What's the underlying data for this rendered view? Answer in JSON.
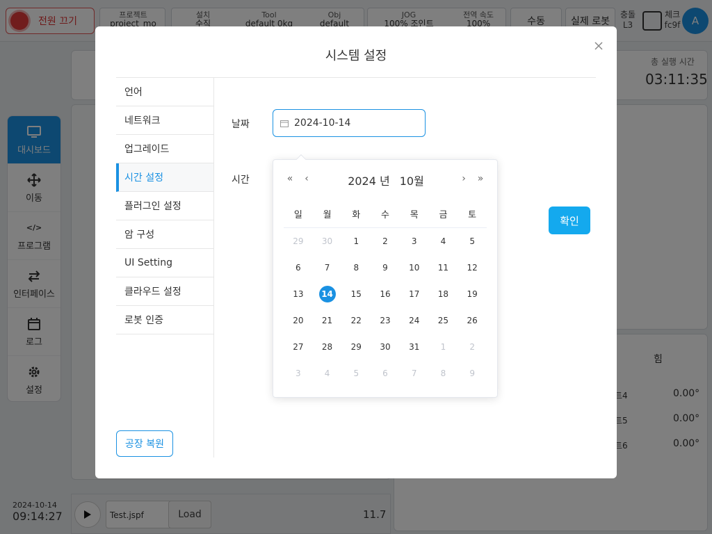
{
  "topbar": {
    "power_label": "전원 끄기",
    "project_label": "프로젝트",
    "project_value": "project_mo",
    "install_label": "설치",
    "install_value": "수직",
    "tool_label": "Tool",
    "tool_value": "default",
    "tool_weight": "0kg",
    "obj_label": "Obj",
    "obj_value": "default",
    "jog_label": "JOG",
    "jog_value": "100%",
    "jog_mode": "조인트",
    "speed_label": "전역 속도",
    "speed_value": "100%",
    "manual_label": "수동",
    "robot_label": "실제 로봇",
    "collision_label": "충돌",
    "collision_value": "L3",
    "check_label": "체크",
    "check_value": "fc9f",
    "avatar": "A"
  },
  "sidenav": {
    "items": [
      {
        "label": "대시보드",
        "icon": "monitor-icon"
      },
      {
        "label": "이동",
        "icon": "move-icon"
      },
      {
        "label": "프로그램",
        "icon": "code-icon"
      },
      {
        "label": "인터페이스",
        "icon": "swap-icon"
      },
      {
        "label": "로그",
        "icon": "calendar-icon"
      },
      {
        "label": "설정",
        "icon": "gear-icon"
      }
    ]
  },
  "background": {
    "runtime_label": "총 실행 시간",
    "runtime_value": "03:11:35",
    "force_label": "힘",
    "joints": [
      {
        "label": "트4",
        "value": "0.00°"
      },
      {
        "label": "트5",
        "value": "0.00°"
      },
      {
        "label": "트6",
        "value": "0.00°"
      }
    ],
    "date": "2024-10-14",
    "time": "09:14:27",
    "file_name": "Test.jspf",
    "load_label": "Load",
    "speed_readout": "11.7"
  },
  "modal": {
    "title": "시스템 설정",
    "menu": [
      "언어",
      "네트워크",
      "업그레이드",
      "시간 설정",
      "플러그인 설정",
      "암 구성",
      "UI Setting",
      "클라우드 설정",
      "로봇 인증"
    ],
    "active_index": 3,
    "factory_reset_label": "공장 복원",
    "date_label": "날짜",
    "date_value": "2024-10-14",
    "time_label": "시간",
    "confirm_label": "확인"
  },
  "picker": {
    "year": "2024 년",
    "month": "10월",
    "weekdays": [
      "일",
      "월",
      "화",
      "수",
      "목",
      "금",
      "토"
    ],
    "days": [
      {
        "d": "29",
        "m": true
      },
      {
        "d": "30",
        "m": true
      },
      {
        "d": "1"
      },
      {
        "d": "2"
      },
      {
        "d": "3"
      },
      {
        "d": "4"
      },
      {
        "d": "5"
      },
      {
        "d": "6"
      },
      {
        "d": "7"
      },
      {
        "d": "8"
      },
      {
        "d": "9"
      },
      {
        "d": "10"
      },
      {
        "d": "11"
      },
      {
        "d": "12"
      },
      {
        "d": "13"
      },
      {
        "d": "14",
        "s": true
      },
      {
        "d": "15"
      },
      {
        "d": "16"
      },
      {
        "d": "17"
      },
      {
        "d": "18"
      },
      {
        "d": "19"
      },
      {
        "d": "20"
      },
      {
        "d": "21"
      },
      {
        "d": "22"
      },
      {
        "d": "23"
      },
      {
        "d": "24"
      },
      {
        "d": "25"
      },
      {
        "d": "26"
      },
      {
        "d": "27"
      },
      {
        "d": "28"
      },
      {
        "d": "29"
      },
      {
        "d": "30"
      },
      {
        "d": "31"
      },
      {
        "d": "1",
        "m": true
      },
      {
        "d": "2",
        "m": true
      },
      {
        "d": "3",
        "m": true
      },
      {
        "d": "4",
        "m": true
      },
      {
        "d": "5",
        "m": true
      },
      {
        "d": "6",
        "m": true
      },
      {
        "d": "7",
        "m": true
      },
      {
        "d": "8",
        "m": true
      },
      {
        "d": "9",
        "m": true
      }
    ],
    "accent": "#1a91e2"
  }
}
